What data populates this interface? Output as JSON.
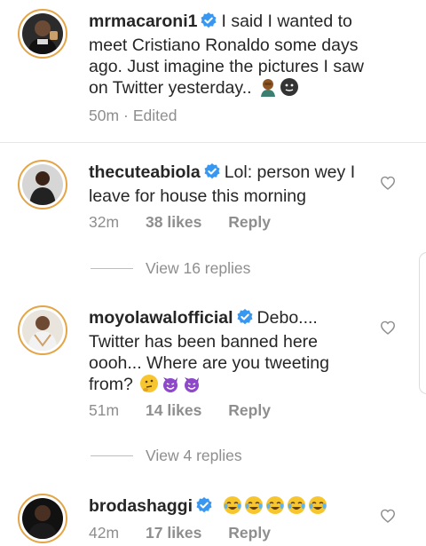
{
  "caption": {
    "username": "mrmacaroni1",
    "text": "I said I wanted to meet Cristiano Ronaldo some days ago. Just imagine the pictures I saw on Twitter yesterday..",
    "time": "50m",
    "separator": "·",
    "edited": "Edited",
    "emojis": [
      "man-facepalming-emoji",
      "face-emoji"
    ]
  },
  "comments": [
    {
      "username": "thecuteabiola",
      "text": "Lol: person wey I leave for house this morning",
      "time": "32m",
      "likes": "38 likes",
      "reply": "Reply",
      "view_replies": "View 16 replies"
    },
    {
      "username": "moyolawalofficial",
      "text": "Debo.... Twitter has been banned here oooh... Where are you tweeting from?",
      "emojis": [
        "thinking-face-emoji",
        "smiling-devil-emoji",
        "smiling-devil-emoji"
      ],
      "time": "51m",
      "likes": "14 likes",
      "reply": "Reply",
      "view_replies": "View 4 replies"
    },
    {
      "username": "brodashaggi",
      "text": "",
      "emojis": [
        "tears-of-joy-emoji",
        "tears-of-joy-emoji",
        "tears-of-joy-emoji",
        "tears-of-joy-emoji",
        "tears-of-joy-emoji"
      ],
      "time": "42m",
      "likes": "17 likes",
      "reply": "Reply"
    }
  ],
  "colors": {
    "text": "#262626",
    "muted": "#8e8e8e",
    "verified": "#3897f0",
    "story_ring": "#e3a547"
  }
}
